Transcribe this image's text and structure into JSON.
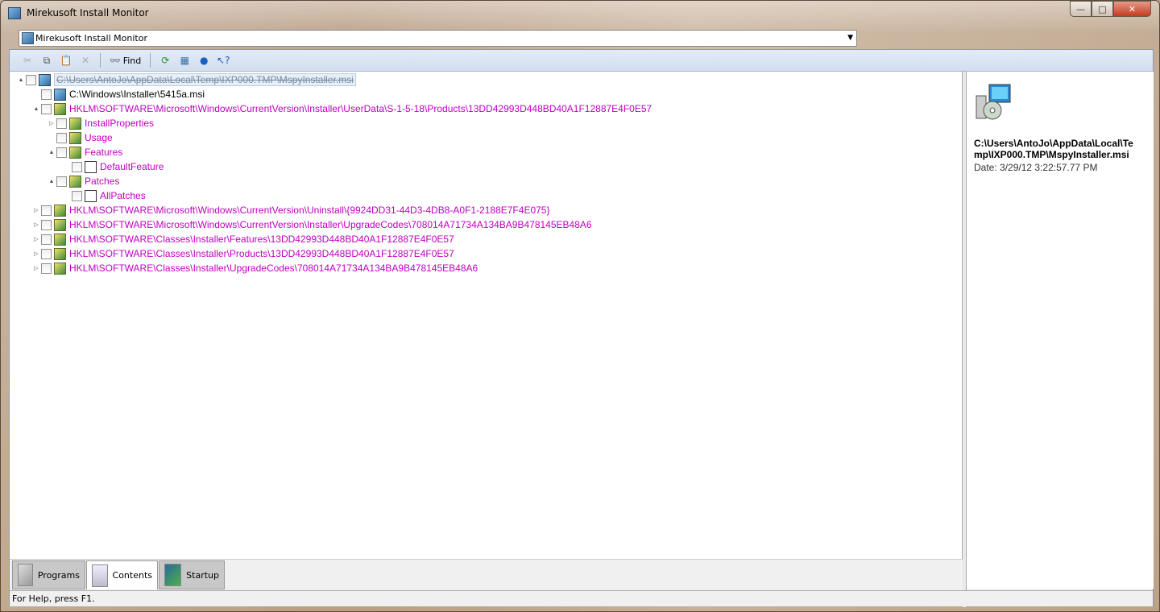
{
  "window": {
    "title": "Mirekusoft Install Monitor",
    "min": "—",
    "max": "□",
    "close": "✕"
  },
  "combo": {
    "value": "Mirekusoft Install Monitor"
  },
  "toolbar": {
    "find_label": "Find"
  },
  "tree": [
    {
      "level": 0,
      "exp": "▲",
      "icon": "msi",
      "label": "C:\\Users\\AntoJo\\AppData\\Local\\Temp\\IXP000.TMP\\MspyInstaller.msi",
      "style": "sel"
    },
    {
      "level": 1,
      "exp": "",
      "icon": "msi",
      "label": "C:\\Windows\\Installer\\5415a.msi",
      "style": ""
    },
    {
      "level": 1,
      "exp": "▲",
      "icon": "reg",
      "label": "HKLM\\SOFTWARE\\Microsoft\\Windows\\CurrentVersion\\Installer\\UserData\\S-1-5-18\\Products\\13DD42993D448BD40A1F12887E4F0E57",
      "style": "mag"
    },
    {
      "level": 2,
      "exp": "▷",
      "icon": "reg",
      "label": "InstallProperties",
      "style": "mag"
    },
    {
      "level": 2,
      "exp": "",
      "icon": "reg",
      "label": "Usage",
      "style": "mag"
    },
    {
      "level": 2,
      "exp": "▲",
      "icon": "reg",
      "label": "Features",
      "style": "mag"
    },
    {
      "level": 3,
      "exp": "",
      "icon": "doc",
      "label": "DefaultFeature",
      "style": "mag"
    },
    {
      "level": 2,
      "exp": "▲",
      "icon": "reg",
      "label": "Patches",
      "style": "mag"
    },
    {
      "level": 3,
      "exp": "",
      "icon": "doc",
      "label": "AllPatches",
      "style": "mag"
    },
    {
      "level": 1,
      "exp": "▷",
      "icon": "reg",
      "label": "HKLM\\SOFTWARE\\Microsoft\\Windows\\CurrentVersion\\Uninstall\\{9924DD31-44D3-4DB8-A0F1-2188E7F4E075}",
      "style": "mag"
    },
    {
      "level": 1,
      "exp": "▷",
      "icon": "reg",
      "label": "HKLM\\SOFTWARE\\Microsoft\\Windows\\CurrentVersion\\Installer\\UpgradeCodes\\708014A71734A134BA9B478145EB48A6",
      "style": "mag"
    },
    {
      "level": 1,
      "exp": "▷",
      "icon": "reg",
      "label": "HKLM\\SOFTWARE\\Classes\\Installer\\Features\\13DD42993D448BD40A1F12887E4F0E57",
      "style": "mag"
    },
    {
      "level": 1,
      "exp": "▷",
      "icon": "reg",
      "label": "HKLM\\SOFTWARE\\Classes\\Installer\\Products\\13DD42993D448BD40A1F12887E4F0E57",
      "style": "mag"
    },
    {
      "level": 1,
      "exp": "▷",
      "icon": "reg",
      "label": "HKLM\\SOFTWARE\\Classes\\Installer\\UpgradeCodes\\708014A71734A134BA9B478145EB48A6",
      "style": "mag"
    }
  ],
  "details": {
    "path": "C:\\Users\\AntoJo\\AppData\\Local\\Temp\\IXP000.TMP\\MspyInstaller.msi",
    "date": "Date: 3/29/12 3:22:57.77 PM"
  },
  "tabs": [
    {
      "label": "Programs"
    },
    {
      "label": "Contents"
    },
    {
      "label": "Startup"
    }
  ],
  "status": {
    "text": "For Help, press F1."
  },
  "colors": {
    "registry_text": "#c000c0",
    "toolbar": "#dce6f4"
  }
}
